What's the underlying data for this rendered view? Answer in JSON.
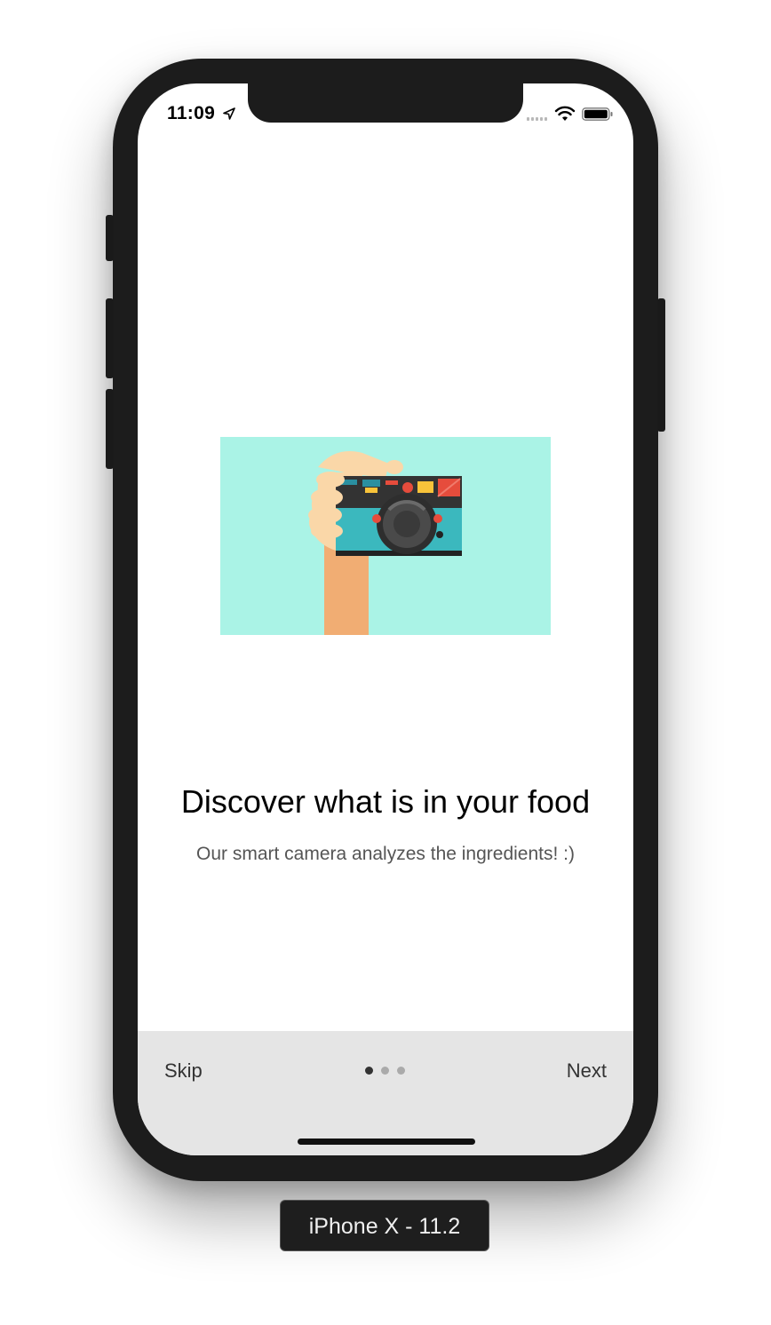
{
  "status_bar": {
    "time": "11:09",
    "location_icon": "location-arrow-icon",
    "signal_icon": "cellular-signal-icon",
    "wifi_icon": "wifi-icon",
    "battery_icon": "battery-icon"
  },
  "onboarding": {
    "illustration_icon": "hand-holding-camera-illustration",
    "title": "Discover what is in your food",
    "subtitle": "Our smart camera analyzes the ingredients! :)"
  },
  "bottom_bar": {
    "skip_label": "Skip",
    "next_label": "Next",
    "page_indicator": {
      "current": 1,
      "total": 3
    }
  },
  "simulator": {
    "device_label": "iPhone X - 11.2"
  },
  "colors": {
    "illustration_bg": "#aaf3e6",
    "bottom_bar_bg": "#e5e5e5",
    "device_frame": "#1c1c1c"
  }
}
